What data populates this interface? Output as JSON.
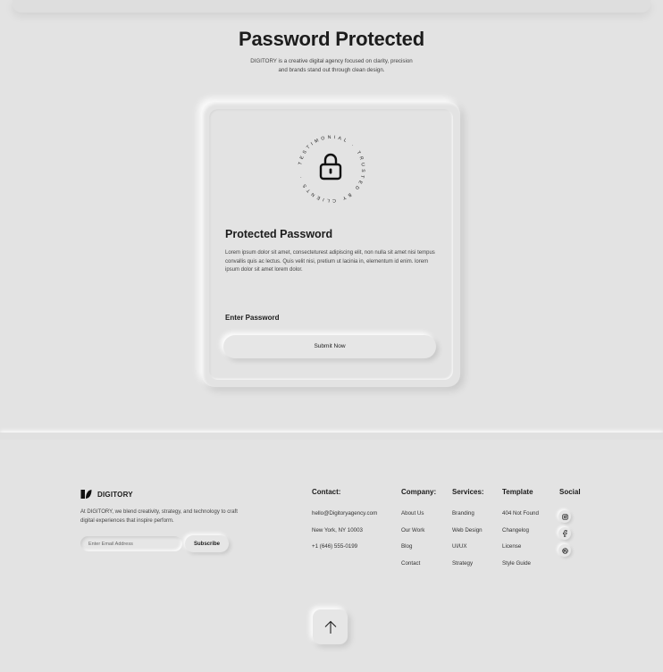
{
  "hero": {
    "title": "Password Protected",
    "subtitle_line1": "DIGITORY is a creative digital agency focused on clarity, precision",
    "subtitle_line2": "and brands stand out through clean design."
  },
  "card": {
    "badge_text": "TESTIMONIAL · TRUSTED BY CLIENTS · ",
    "lock_icon": "lock-icon",
    "title": "Protected Password",
    "description": "Lorem ipsum dolor sit amet, consecteturest adipiscing elit, non nulla sit amet nisi tempus convallis quis ac lectus. Quis velit nisi, pretium ut lacinia in, elementum id enim. lorem ipsum dolor sit amet lorem dolor.",
    "password_label": "Enter Password",
    "submit_label": "Submit Now"
  },
  "footer": {
    "brand_name": "DIGITORY",
    "brand_desc": "At DIGITORY, we blend creativity, strategy, and technology to craft digital experiences that inspire perform.",
    "email_placeholder": "Enter Email Address",
    "subscribe_label": "Subscribe",
    "contact": {
      "title": "Contact:",
      "items": [
        "hello@Digitoryagency.com",
        "New York, NY 10003",
        "+1 (646) 555-0199"
      ]
    },
    "company": {
      "title": "Company:",
      "items": [
        "About Us",
        "Our Work",
        "Blog",
        "Contact"
      ]
    },
    "services": {
      "title": "Services:",
      "items": [
        "Branding",
        "Web Design",
        "UI/UX",
        "Strategy"
      ]
    },
    "template": {
      "title": "Template",
      "items": [
        "404 Not Found",
        "Changelog",
        "License",
        "Style Guide"
      ]
    },
    "social": {
      "title": "Social",
      "icons": [
        "instagram-icon",
        "facebook-icon",
        "dribbble-icon"
      ]
    },
    "back_to_top_icon": "arrow-up-icon"
  }
}
